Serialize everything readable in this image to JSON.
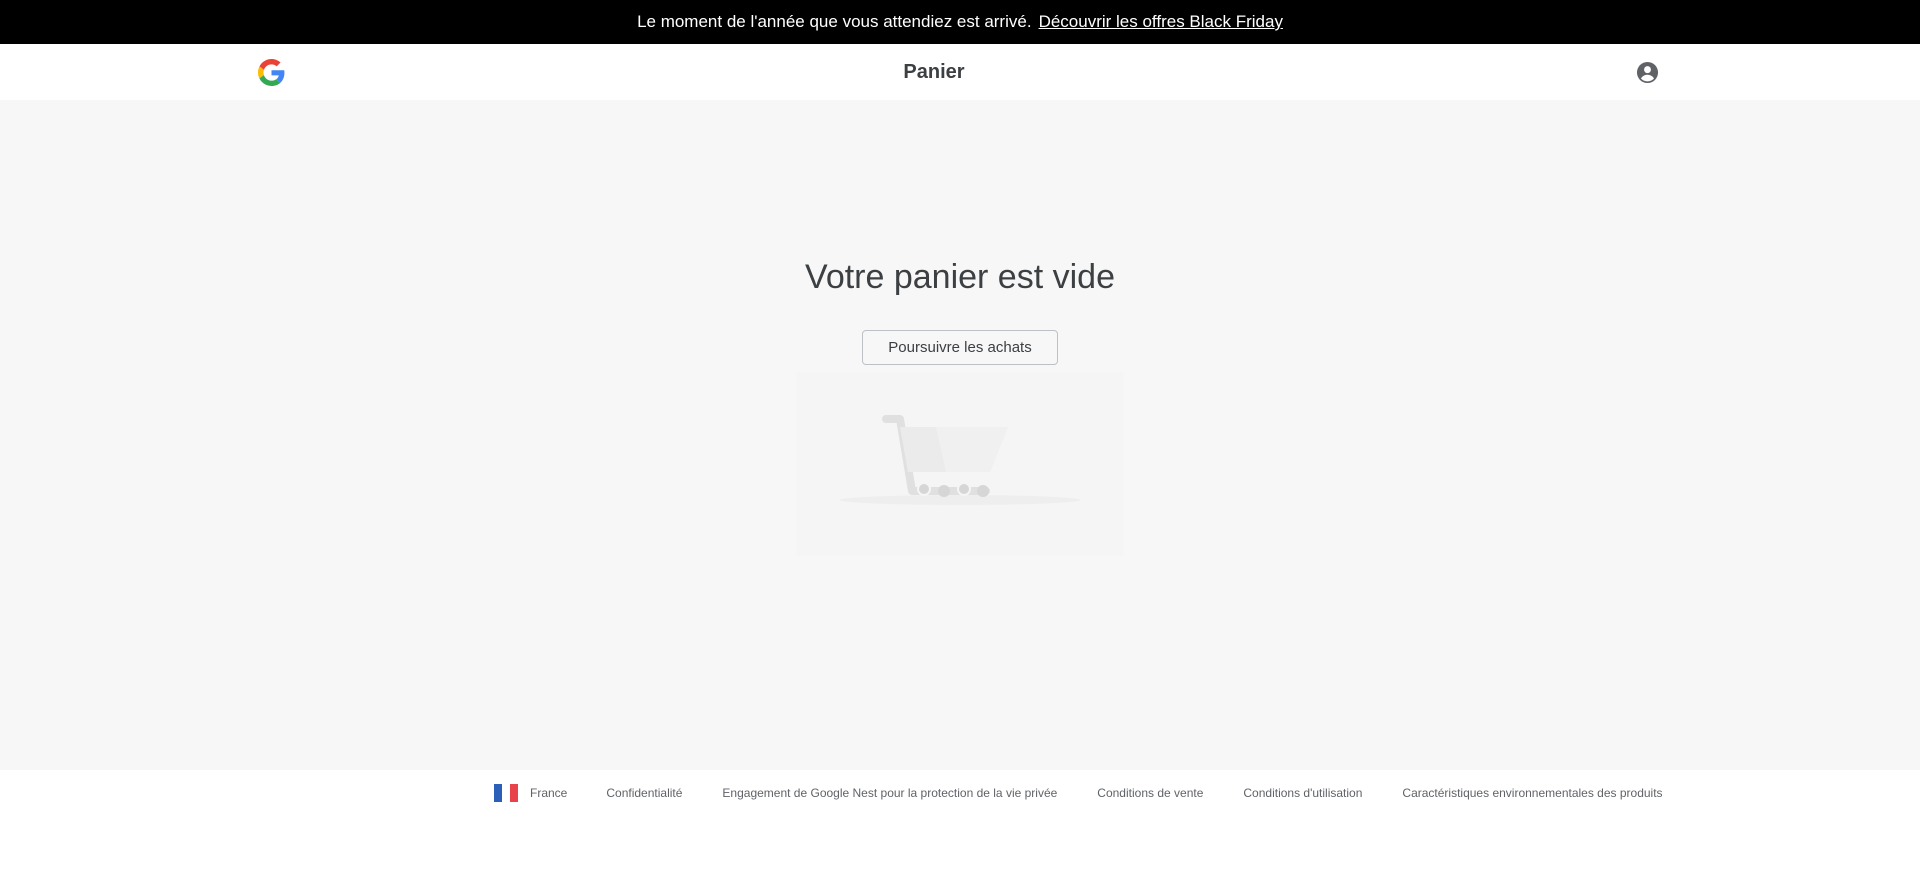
{
  "promo": {
    "text": "Le moment de l'année que vous attendiez est arrivé.",
    "link_label": "Découvrir les offres Black Friday"
  },
  "header": {
    "logo_icon": "google-g-logo",
    "title": "Panier",
    "account_icon": "account-circle-icon"
  },
  "main": {
    "heading": "Votre panier est vide",
    "continue_button_label": "Poursuivre les achats",
    "illustration_icon": "shopping-cart-icon"
  },
  "footer": {
    "country": "France",
    "flag_colors": [
      "#2b5fb8",
      "#ffffff",
      "#e8424b"
    ],
    "links": [
      "Confidentialité",
      "Engagement de Google Nest pour la protection de la vie privée",
      "Conditions de vente",
      "Conditions d'utilisation",
      "Caractéristiques environnementales des produits"
    ]
  },
  "colors": {
    "banner_bg": "#000000",
    "page_bg": "#f7f7f7",
    "text": "#3c4043",
    "footer_text": "#5f6368"
  }
}
